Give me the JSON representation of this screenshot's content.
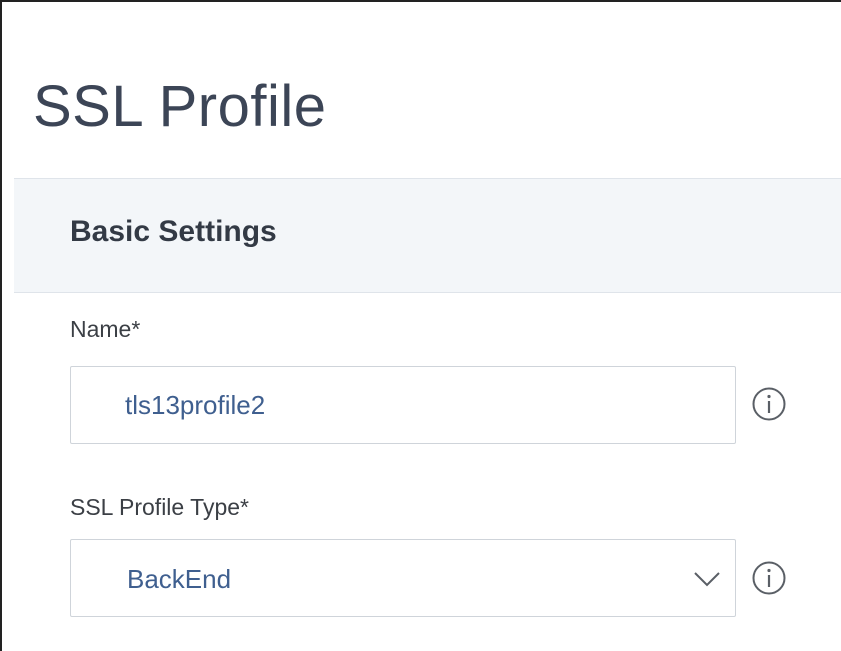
{
  "page": {
    "title": "SSL Profile"
  },
  "section": {
    "title": "Basic Settings"
  },
  "fields": {
    "name": {
      "label": "Name*",
      "value": "tls13profile2",
      "icon": "info-icon"
    },
    "profile_type": {
      "label": "SSL Profile Type*",
      "selected": "BackEnd",
      "icon": "info-icon"
    }
  },
  "colors": {
    "title": "#3c4556",
    "section_bg": "#f3f6f9",
    "input_text": "#3f5f8f",
    "border": "#cfd4da"
  }
}
